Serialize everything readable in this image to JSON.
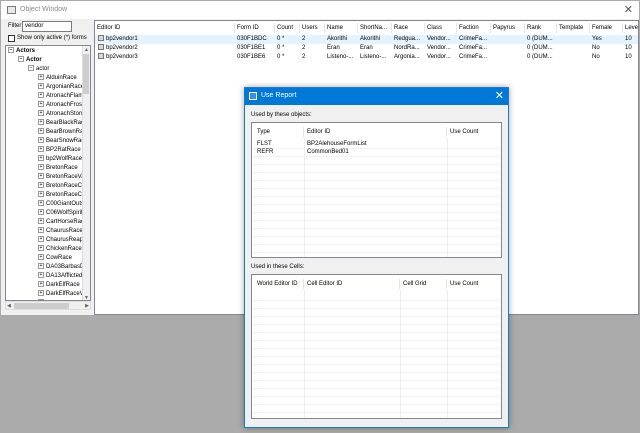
{
  "window": {
    "title": "Object Window",
    "close": "✕"
  },
  "filter": {
    "label": "Filter",
    "value": "vendor"
  },
  "show_active": {
    "label": "Show only active (*) forms",
    "checked": false
  },
  "tree": {
    "root": "Actors",
    "level1": "Actor",
    "level2": "actor",
    "items": [
      "AlduinRace",
      "ArgonianRace",
      "AtronachFlameRace",
      "AtronachFrostRace",
      "AtronachStormRace",
      "BearBlackRace",
      "BearBrownRace",
      "BearSnowRace",
      "BP2RatRace",
      "bp2WolfRace",
      "BretonRace",
      "BretonRaceVampire",
      "BretonRaceChild",
      "BretonRaceChildVampire",
      "C00GiantOutsideWhiterunRace",
      "C06WolfSpiritRace",
      "CartHorseRace",
      "ChaurusRace",
      "ChaurusReaperRace",
      "ChickenRace",
      "CowRace",
      "DA03BarbasDogRace",
      "DA13AfflictedRace",
      "DarkElfRace",
      "DarkElfRaceVampire",
      "DeerRace",
      "DefaultRace"
    ]
  },
  "grid": {
    "columns": [
      "Editor ID",
      "Form ID",
      "Count",
      "Users",
      "Name",
      "ShortNa...",
      "Race",
      "Class",
      "Faction",
      "Papyrus",
      "Rank",
      "Template",
      "Female",
      "Leve"
    ],
    "rows": [
      [
        "bp2vendor1",
        "030F1BDC",
        "0 *",
        "2",
        "Akorithi",
        "Akorithi",
        "Redgua...",
        "Vendor...",
        "CrimeFa...",
        "",
        "0 (DUM...",
        "",
        "Yes",
        "10"
      ],
      [
        "bp2vendor2",
        "030F1BE1",
        "0 *",
        "2",
        "Eran",
        "Eran",
        "NordRa...",
        "Vendor...",
        "CrimeFa...",
        "",
        "0 (DUM...",
        "",
        "No",
        "10"
      ],
      [
        "bp2vendor3",
        "030F1BE6",
        "0 *",
        "2",
        "Listeno-...",
        "Listeno-...",
        "Argonia...",
        "Vendor...",
        "CrimeFa...",
        "",
        "0 (DUM...",
        "",
        "No",
        "10"
      ]
    ]
  },
  "dialog": {
    "title": "Use Report",
    "close": "✕",
    "objects_label": "Used by these objects:",
    "objects_columns": [
      "Type",
      "Editor ID",
      "Use Count"
    ],
    "objects_rows": [
      [
        "FLST",
        "BP2AlehouseFormList",
        ""
      ],
      [
        "REFR",
        "CommonBed01",
        ""
      ]
    ],
    "cells_label": "Used in these Cells:",
    "cells_columns": [
      "World Editor ID",
      "Cell Editor ID",
      "Cell Grid",
      "Use Count"
    ]
  }
}
